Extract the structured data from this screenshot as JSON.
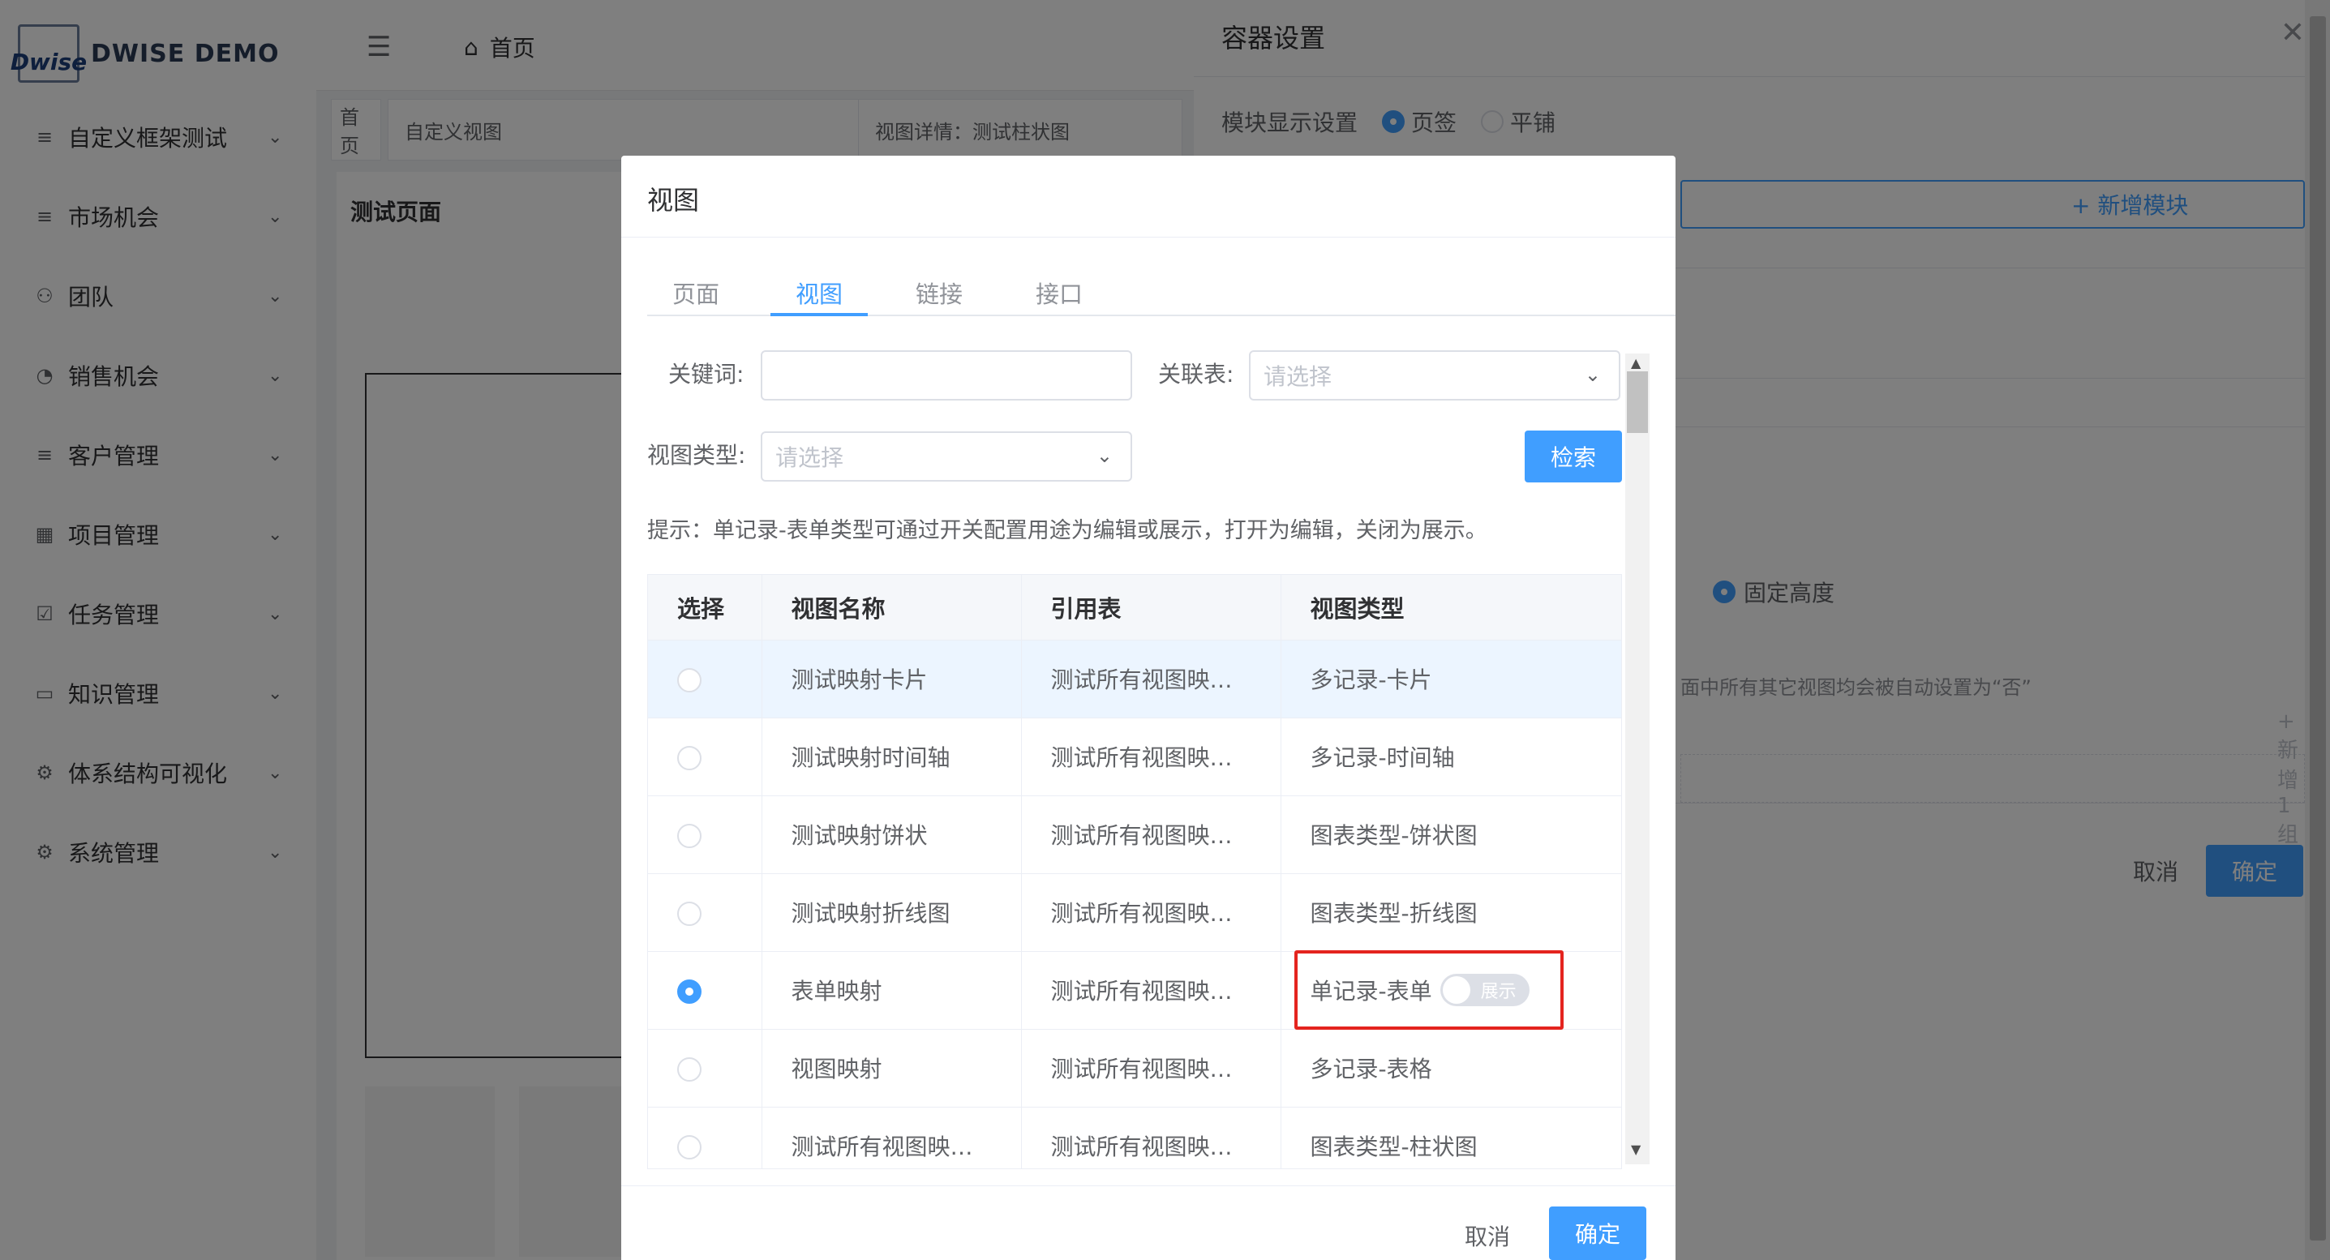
{
  "app": {
    "logo_mark": "Dwise",
    "logo_text": "DWISE DEMO",
    "home_crumb": "首页"
  },
  "sidebar": {
    "items": [
      {
        "icon": "list-icon",
        "glyph": "≡",
        "label": "自定义框架测试"
      },
      {
        "icon": "list-icon",
        "glyph": "≡",
        "label": "市场机会"
      },
      {
        "icon": "team-icon",
        "glyph": "⚇",
        "label": "团队"
      },
      {
        "icon": "pie-icon",
        "glyph": "◔",
        "label": "销售机会"
      },
      {
        "icon": "list-icon",
        "glyph": "≡",
        "label": "客户管理"
      },
      {
        "icon": "grid-icon",
        "glyph": "▦",
        "label": "项目管理"
      },
      {
        "icon": "check-icon",
        "glyph": "☑",
        "label": "任务管理"
      },
      {
        "icon": "book-icon",
        "glyph": "▭",
        "label": "知识管理"
      },
      {
        "icon": "structure-icon",
        "glyph": "⚙",
        "label": "体系结构可视化"
      },
      {
        "icon": "gear-icon",
        "glyph": "⚙",
        "label": "系统管理"
      }
    ]
  },
  "page_tabs": {
    "home": "首页",
    "custom_view": "自定义视图",
    "view_detail": "视图详情：测试柱状图"
  },
  "page": {
    "title": "测试页面"
  },
  "drawer": {
    "title": "容器设置",
    "display_setting_label": "模块显示设置",
    "option_tabs": "页签",
    "option_tile": "平铺",
    "add_module": "+ 新增模块",
    "fixed_height": "固定高度",
    "partial_hint": "面中所有其它视图均会被自动设置为“否”",
    "add_group": "+ 新增1组",
    "cancel": "取消",
    "ok": "确定"
  },
  "modal": {
    "title": "视图",
    "tabs": [
      "页面",
      "视图",
      "链接",
      "接口"
    ],
    "active_tab": "视图",
    "keyword_label": "关键词:",
    "keyword_value": "",
    "related_label": "关联表:",
    "related_placeholder": "请选择",
    "type_label": "视图类型:",
    "type_placeholder": "请选择",
    "search_button": "检索",
    "hint": "提示：单记录-表单类型可通过开关配置用途为编辑或展示，打开为编辑，关闭为展示。",
    "columns": [
      "选择",
      "视图名称",
      "引用表",
      "视图类型"
    ],
    "rows": [
      {
        "name": "测试映射卡片",
        "table": "测试所有视图映…",
        "type": "多记录-卡片",
        "selected": false,
        "highlight": true
      },
      {
        "name": "测试映射时间轴",
        "table": "测试所有视图映…",
        "type": "多记录-时间轴",
        "selected": false
      },
      {
        "name": "测试映射饼状",
        "table": "测试所有视图映…",
        "type": "图表类型-饼状图",
        "selected": false
      },
      {
        "name": "测试映射折线图",
        "table": "测试所有视图映…",
        "type": "图表类型-折线图",
        "selected": false
      },
      {
        "name": "表单映射",
        "table": "测试所有视图映…",
        "type": "单记录-表单",
        "selected": true,
        "switch": "展示"
      },
      {
        "name": "视图映射",
        "table": "测试所有视图映…",
        "type": "多记录-表格",
        "selected": false
      },
      {
        "name": "测试所有视图映…",
        "table": "测试所有视图映…",
        "type": "图表类型-柱状图",
        "selected": false
      }
    ],
    "cancel": "取消",
    "ok": "确定"
  }
}
